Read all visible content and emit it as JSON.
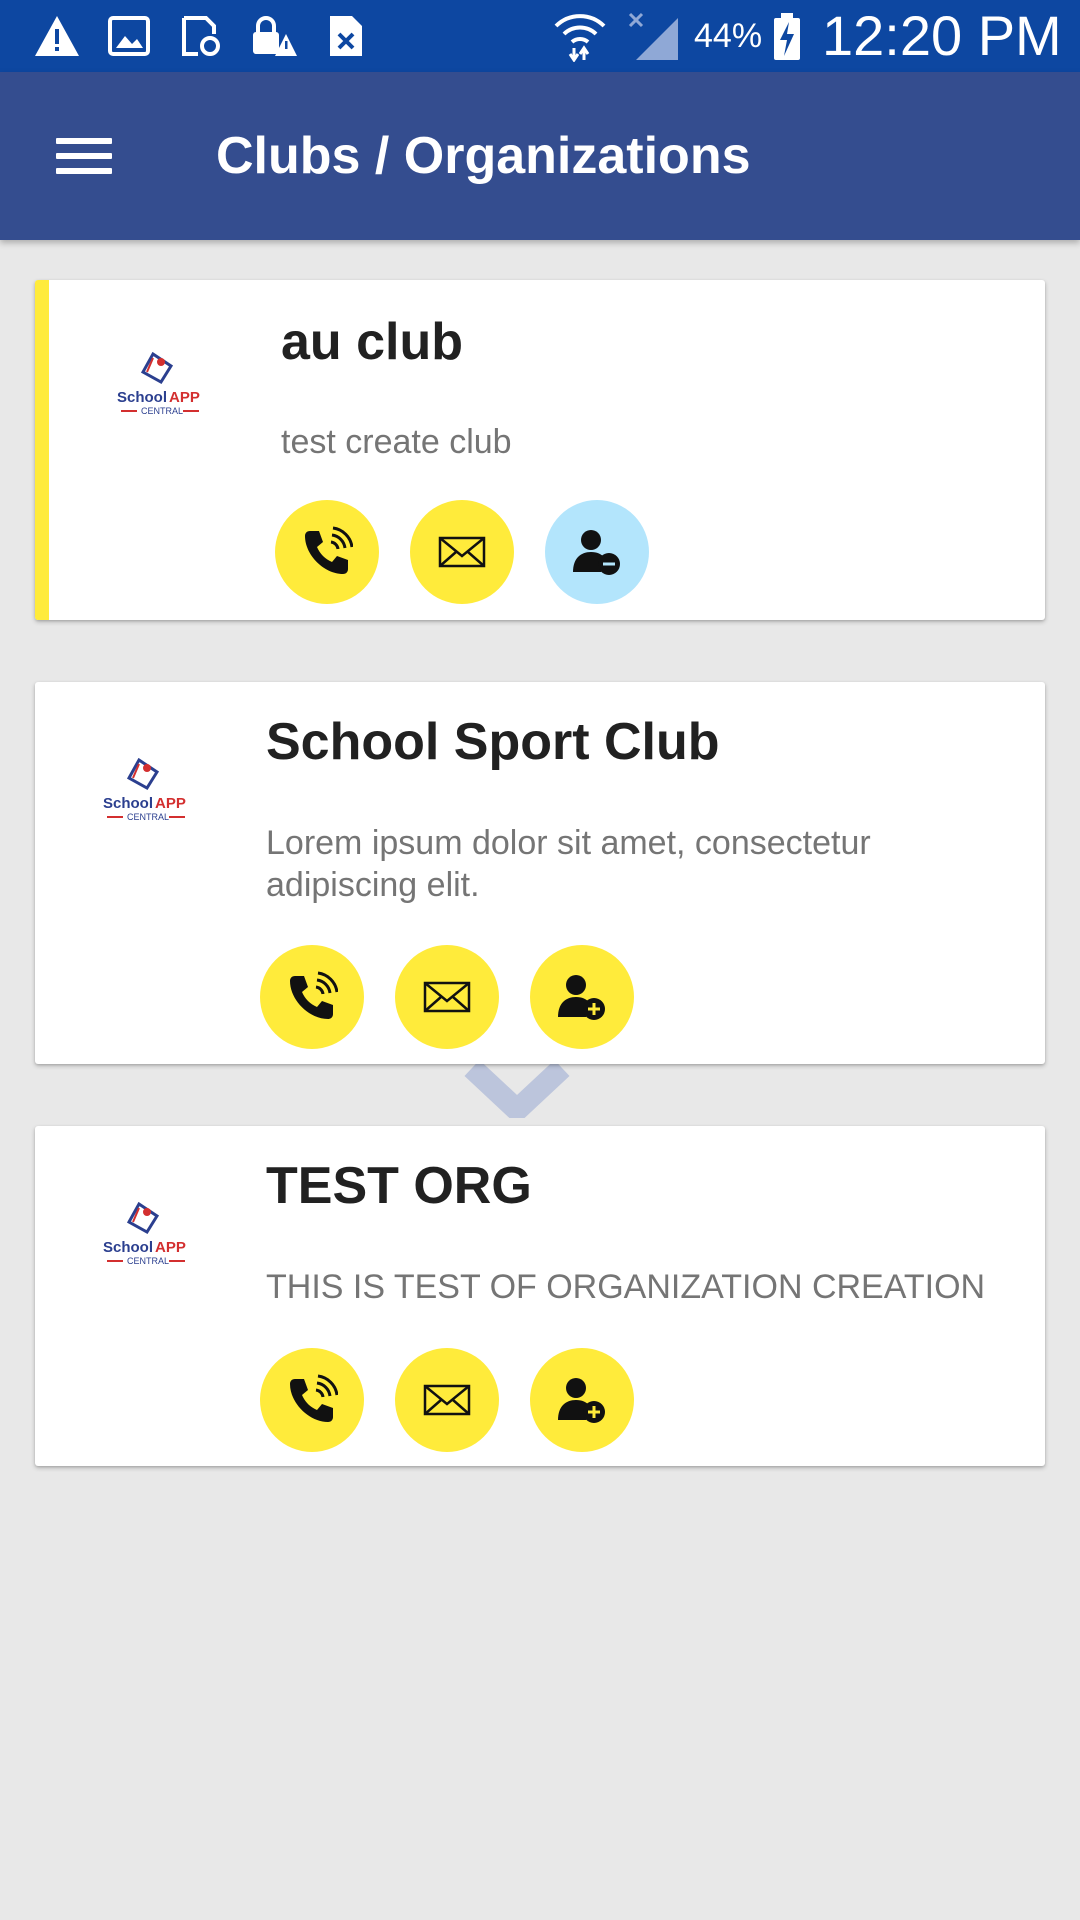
{
  "status_bar": {
    "icons": [
      "warning-icon",
      "image-icon",
      "sync-icon",
      "lock-warning-icon",
      "file-x-icon",
      "wifi-icon",
      "signal-icon",
      "battery-charging-icon"
    ],
    "battery_percent": "44%",
    "time": "12:20 PM"
  },
  "app_bar": {
    "menu_icon": "hamburger-menu-icon",
    "title": "Clubs / Organizations"
  },
  "colors": {
    "status_bar": "#0d47a1",
    "app_bar": "#344d8f",
    "accent_yellow": "#ffeb3b",
    "light_blue": "#b3e5fc",
    "background": "#e8e8e8"
  },
  "logo": {
    "line1_a": "School",
    "line1_b": "APP",
    "line2": "CENTRAL"
  },
  "clubs": [
    {
      "name": "au club",
      "description": "test create club",
      "selected": true,
      "actions": [
        {
          "icon": "phone-icon",
          "color": "#ffeb3b"
        },
        {
          "icon": "mail-icon",
          "color": "#ffeb3b"
        },
        {
          "icon": "user-remove-icon",
          "color": "#b3e5fc"
        }
      ]
    },
    {
      "name": "School Sport Club",
      "description": "Lorem ipsum dolor sit amet, consectetur adipiscing elit.",
      "selected": false,
      "actions": [
        {
          "icon": "phone-icon",
          "color": "#ffeb3b"
        },
        {
          "icon": "mail-icon",
          "color": "#ffeb3b"
        },
        {
          "icon": "user-add-icon",
          "color": "#ffeb3b"
        }
      ]
    },
    {
      "name": "TEST ORG",
      "description": "THIS IS TEST OF ORGANIZATION CREATION",
      "selected": false,
      "actions": [
        {
          "icon": "phone-icon",
          "color": "#ffeb3b"
        },
        {
          "icon": "mail-icon",
          "color": "#ffeb3b"
        },
        {
          "icon": "user-add-icon",
          "color": "#ffeb3b"
        }
      ]
    }
  ]
}
